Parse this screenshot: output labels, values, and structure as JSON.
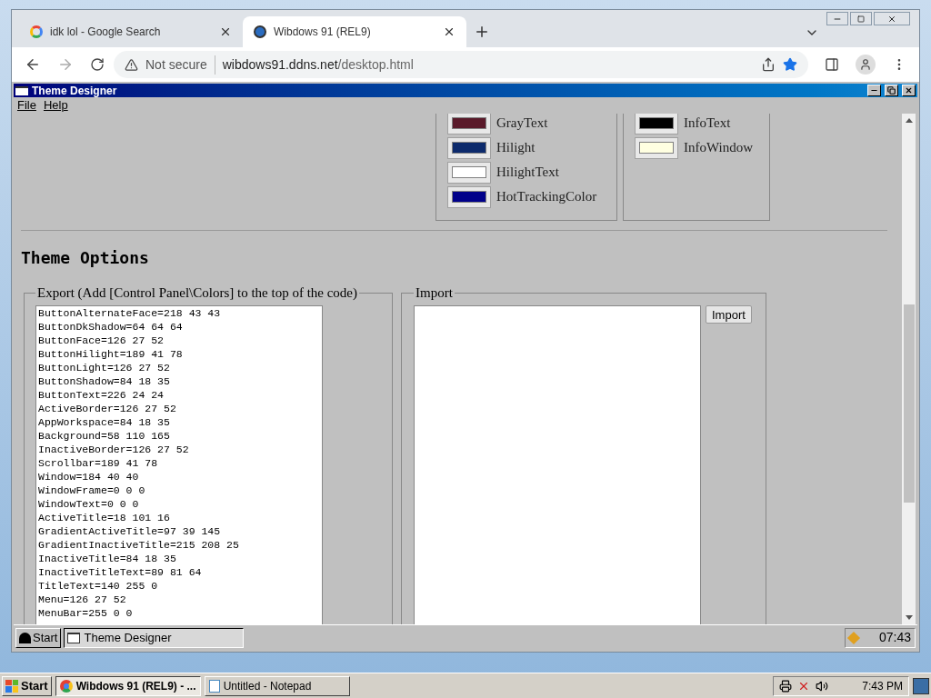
{
  "browser": {
    "tabs": [
      {
        "title": "idk lol - Google Search",
        "selected": false
      },
      {
        "title": "Wibdows 91 (REL9)",
        "selected": true
      }
    ],
    "security": "Not secure",
    "url_host": "wibdows91.ddns.net",
    "url_path": "/desktop.html",
    "bookmarked": true
  },
  "window": {
    "title": "Theme Designer",
    "menu": [
      "File",
      "Help"
    ]
  },
  "swatch_groups": [
    {
      "items": [
        {
          "label": "GrayText",
          "color": "#5a1a2a"
        },
        {
          "label": "Hilight",
          "color": "#0c2a6c"
        },
        {
          "label": "HilightText",
          "color": "#ffffff"
        },
        {
          "label": "HotTrackingColor",
          "color": "#00008a"
        }
      ]
    },
    {
      "items": [
        {
          "label": "InfoText",
          "color": "#000000"
        },
        {
          "label": "InfoWindow",
          "color": "#ffffe1"
        }
      ]
    }
  ],
  "heading": "Theme Options",
  "export": {
    "legend": "Export (Add [Control Panel\\Colors] to the top of the code)",
    "lines": [
      "ButtonAlternateFace=218 43 43",
      "ButtonDkShadow=64 64 64",
      "ButtonFace=126 27 52",
      "ButtonHilight=189 41 78",
      "ButtonLight=126 27 52",
      "ButtonShadow=84 18 35",
      "ButtonText=226 24 24",
      "ActiveBorder=126 27 52",
      "AppWorkspace=84 18 35",
      "Background=58 110 165",
      "InactiveBorder=126 27 52",
      "Scrollbar=189 41 78",
      "Window=184 40 40",
      "WindowFrame=0 0 0",
      "WindowText=0 0 0",
      "ActiveTitle=18 101 16",
      "GradientActiveTitle=97 39 145",
      "GradientInactiveTitle=215 208 25",
      "InactiveTitle=84 18 35",
      "InactiveTitleText=89 81 64",
      "TitleText=140 255 0",
      "Menu=126 27 52",
      "MenuBar=255 0 0"
    ]
  },
  "import": {
    "legend": "Import",
    "button": "Import"
  },
  "inner_taskbar": {
    "start": "Start",
    "tasks": [
      {
        "title": "Theme Designer",
        "selected": true
      }
    ],
    "clock": "07:43"
  },
  "taskbar": {
    "start": "Start",
    "tasks": [
      {
        "title": "Wibdows 91 (REL9) - ...",
        "selected": true
      },
      {
        "title": "Untitled - Notepad",
        "selected": false
      }
    ],
    "clock": "7:43 PM"
  }
}
